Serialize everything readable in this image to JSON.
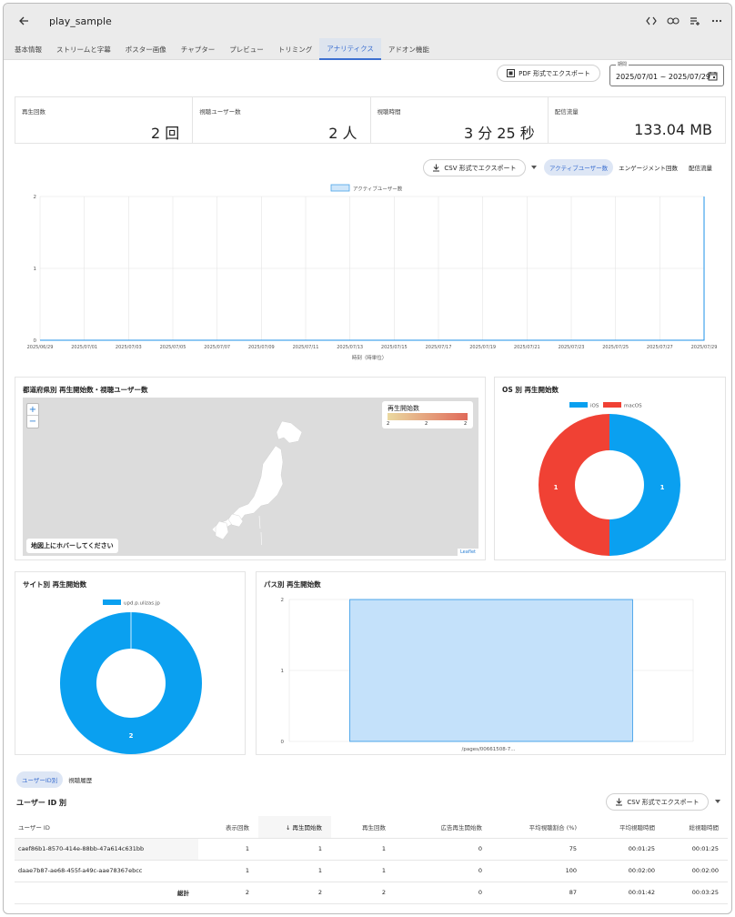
{
  "app": {
    "title": "play_sample"
  },
  "tabs": [
    "基本情報",
    "ストリームと字幕",
    "ポスター画像",
    "チャプター",
    "プレビュー",
    "トリミング",
    "アナリティクス",
    "アドオン機能"
  ],
  "active_tab": "アナリティクス",
  "pdf_export": "PDF 形式でエクスポート",
  "period": {
    "label": "期間",
    "value": "2025/07/01 ~ 2025/07/29"
  },
  "stats": [
    {
      "label": "再生回数",
      "value": "2 回"
    },
    {
      "label": "視聴ユーザー数",
      "value": "2 人"
    },
    {
      "label": "視聴時間",
      "value": "3 分 25 秒"
    },
    {
      "label": "配信流量",
      "value": "133.04 MB"
    }
  ],
  "csv_export": "CSV 形式でエクスポート",
  "segments": [
    "アクティブユーザー数",
    "エンゲージメント回数",
    "配信流量"
  ],
  "line_chart": {
    "legend": "アクティブユーザー数",
    "xlabel": "時刻（時単位）",
    "yticks": [
      "0",
      "1",
      "2"
    ],
    "xticks": [
      "2025/06/29",
      "2025/07/01",
      "2025/07/03",
      "2025/07/05",
      "2025/07/07",
      "2025/07/09",
      "2025/07/11",
      "2025/07/13",
      "2025/07/15",
      "2025/07/17",
      "2025/07/19",
      "2025/07/21",
      "2025/07/23",
      "2025/07/25",
      "2025/07/27",
      "2025/07/29"
    ]
  },
  "map": {
    "title": "都道府県別 再生開始数・視聴ユーザー数",
    "legend_title": "再生開始数",
    "legend_ticks": [
      "2",
      "2",
      "2"
    ],
    "zoom_in": "+",
    "zoom_out": "−",
    "hover_hint": "地図上にホバーしてください",
    "attribution": "Leaflet"
  },
  "os_chart": {
    "title": "OS 別 再生開始数",
    "legend": [
      "iOS",
      "macOS"
    ],
    "labels": [
      "1",
      "1"
    ],
    "colors": [
      "#0aa0f0",
      "#f04134"
    ]
  },
  "site_chart": {
    "title": "サイト別 再生開始数",
    "legend": "upd.p.ulizas.jp",
    "label": "2",
    "color": "#0aa0f0"
  },
  "path_chart": {
    "title": "パス別 再生開始数",
    "yticks": [
      "0",
      "1",
      "2"
    ],
    "xlabel": "/pages/00661508-7..."
  },
  "chart_data": [
    {
      "type": "line",
      "title": "",
      "legend": [
        "アクティブユーザー数"
      ],
      "xlabel": "時刻（時単位）",
      "x_range": [
        "2025/06/29",
        "2025/07/29"
      ],
      "ylim": [
        0,
        2
      ],
      "series": [
        {
          "name": "アクティブユーザー数",
          "points": [
            [
              "2025/06/29",
              0
            ],
            [
              "2025/07/29 00:00",
              0
            ],
            [
              "2025/07/29 01:00",
              2
            ]
          ]
        }
      ]
    },
    {
      "type": "pie",
      "title": "OS 別 再生開始数",
      "categories": [
        "iOS",
        "macOS"
      ],
      "values": [
        1,
        1
      ]
    },
    {
      "type": "pie",
      "title": "サイト別 再生開始数",
      "categories": [
        "upd.p.ulizas.jp"
      ],
      "values": [
        2
      ]
    },
    {
      "type": "bar",
      "title": "パス別 再生開始数",
      "categories": [
        "/pages/00661508-7..."
      ],
      "values": [
        2
      ],
      "ylim": [
        0,
        2
      ]
    }
  ],
  "subtabs": [
    "ユーザーID別",
    "視聴履歴"
  ],
  "table": {
    "title": "ユーザー ID 別",
    "csv": "CSV 形式でエクスポート",
    "headers": [
      "ユーザー ID",
      "表示回数",
      "↓ 再生開始数",
      "再生回数",
      "広告再生開始数",
      "平均視聴割合 (%)",
      "平均視聴時間",
      "総視聴時間"
    ],
    "rows": [
      [
        "caef86b1-8570-414e-88bb-47a614c631bb",
        "1",
        "1",
        "1",
        "0",
        "75",
        "00:01:25",
        "00:01:25"
      ],
      [
        "daae7b87-ae68-455f-a49c-aae78367ebcc",
        "1",
        "1",
        "1",
        "0",
        "100",
        "00:02:00",
        "00:02:00"
      ]
    ],
    "total": [
      "総計",
      "2",
      "2",
      "2",
      "0",
      "87",
      "00:01:42",
      "00:03:25"
    ]
  }
}
